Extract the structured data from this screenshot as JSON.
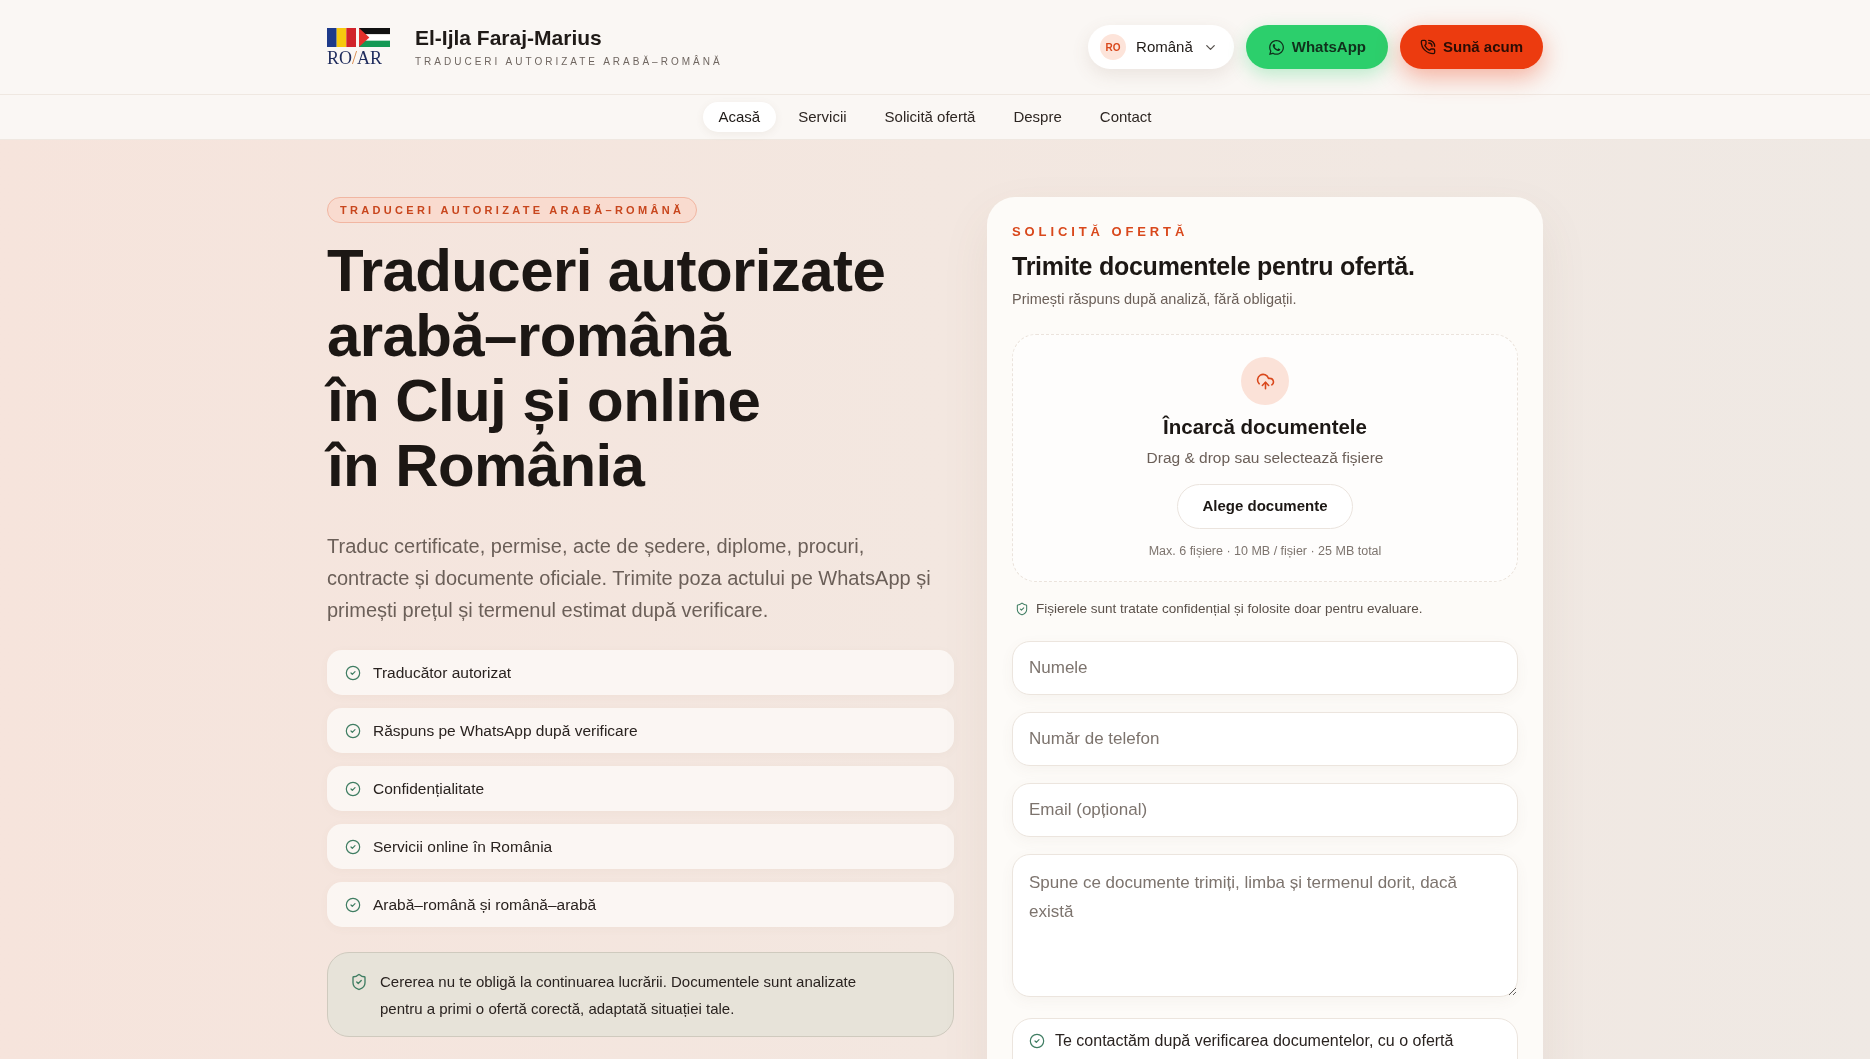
{
  "header": {
    "logo": {
      "left": "RO",
      "separator": "/",
      "right": "AR"
    },
    "name": "El-Ijla Faraj-Marius",
    "tagline": "TRADUCERI AUTORIZATE ARABĂ–ROMÂNĂ",
    "language": {
      "code": "RO",
      "label": "Română"
    },
    "buttons": [
      {
        "kind": "whatsapp",
        "label": "WhatsApp"
      },
      {
        "kind": "call",
        "label": "Sună acum"
      }
    ]
  },
  "nav": [
    {
      "label": "Acasă",
      "selected": true
    },
    {
      "label": "Servicii",
      "selected": false
    },
    {
      "label": "Solicită ofertă",
      "selected": false
    },
    {
      "label": "Despre",
      "selected": false
    },
    {
      "label": "Contact",
      "selected": false
    }
  ],
  "hero": {
    "badge": "TRADUCERI AUTORIZATE ARABĂ–ROMÂNĂ",
    "title": "Traduceri autorizate\narabă–română\nîn Cluj și online\nîn România",
    "description": "Traduc certificate, permise, acte de ședere, diplome, procuri, contracte și documente oficiale. Trimite poza actului pe WhatsApp și primești prețul și termenul estimat după verificare.",
    "features": [
      "Traducător autorizat",
      "Răspuns pe WhatsApp după verificare",
      "Confidențialitate",
      "Servicii online în România",
      "Arabă–română și română–arabă"
    ],
    "note": "Cererea nu te obligă la continuarea lucrării. Documentele sunt analizate pentru a primi o ofertă corectă, adaptată situației tale."
  },
  "quote_form": {
    "eyebrow": "SOLICITĂ OFERTĂ",
    "title": "Trimite documentele pentru ofertă.",
    "subtitle": "Primești răspuns după analiză, fără obligații.",
    "upload": {
      "title": "Încarcă documentele",
      "hint": "Drag & drop sau selectează fișiere",
      "button": "Alege documente",
      "limits": "Max. 6 fișiere · 10 MB / fișier · 25 MB total"
    },
    "privacy_note": "Fișierele sunt tratate confidențial și folosite doar pentru evaluare.",
    "fields": [
      {
        "kind": "input",
        "placeholder": "Numele"
      },
      {
        "kind": "input",
        "placeholder": "Număr de telefon"
      },
      {
        "kind": "input",
        "placeholder": "Email (opțional)"
      },
      {
        "kind": "textarea",
        "placeholder": "Spune ce documente trimiți, limba și termenul dorit, dacă există"
      }
    ],
    "contact_note": "Te contactăm după verificarea documentelor, cu o ofertă"
  }
}
